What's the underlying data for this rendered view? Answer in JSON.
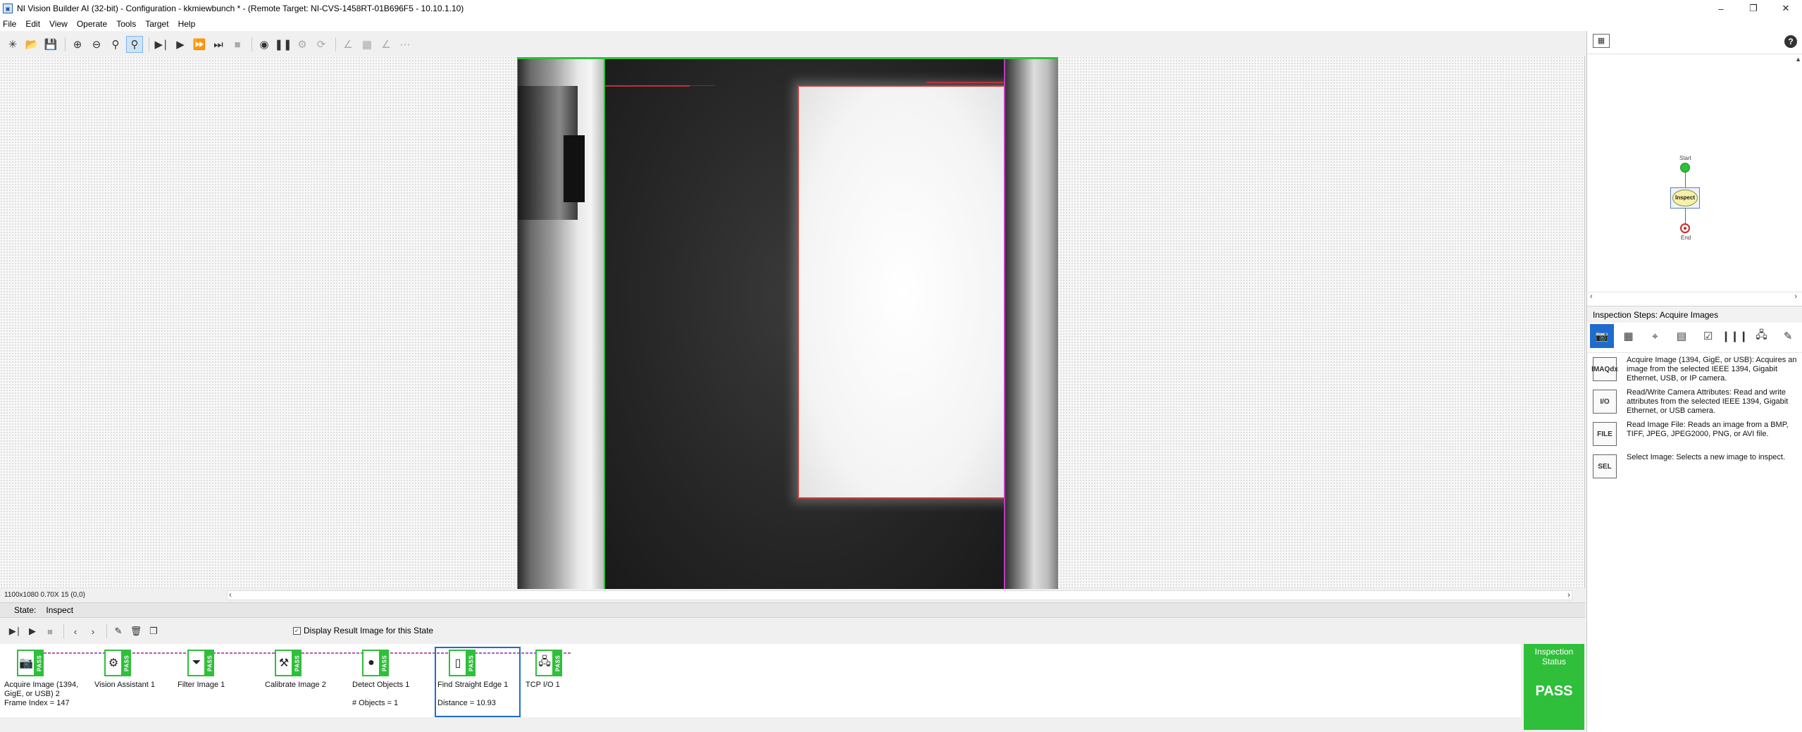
{
  "window": {
    "title": "NI Vision Builder AI (32-bit) - Configuration - kkmiewbunch * - (Remote Target: NI-CVS-1458RT-01B696F5 - 10.10.1.10)",
    "minimize": "–",
    "maximize": "❐",
    "close": "✕"
  },
  "menu": [
    "File",
    "Edit",
    "View",
    "Operate",
    "Tools",
    "Target",
    "Help"
  ],
  "toolbar": {
    "icons": [
      "new-icon",
      "open-icon",
      "save-icon",
      "zoom-in-icon",
      "zoom-out-icon",
      "zoom-fit-icon",
      "zoom-tool-icon",
      "run-once-icon",
      "run-icon",
      "run-continuous-icon",
      "step-icon",
      "stop-icon",
      "breakpoint-icon",
      "pause-icon",
      "calibration-icon",
      "reset-icon",
      "overlay1-icon",
      "overlay2-icon",
      "overlay3-icon",
      "overlay4-icon"
    ]
  },
  "image_status": {
    "resolution": "1100x1080 0.70X 15   (0,0)"
  },
  "state_bar": {
    "label": "State:",
    "value": "Inspect"
  },
  "steps_toolbar": {
    "display_result_label": "Display Result Image for this State",
    "display_result_checked": true
  },
  "steps": [
    {
      "name": "Acquire Image (1394, GigE, or USB) 2",
      "result": "Frame Index = 147",
      "status": "PASS",
      "icon": "camera-icon"
    },
    {
      "name": "Vision Assistant 1",
      "result": "",
      "status": "PASS",
      "icon": "vision-assistant-icon"
    },
    {
      "name": "Filter Image 1",
      "result": "",
      "status": "PASS",
      "icon": "filter-icon"
    },
    {
      "name": "Calibrate Image 2",
      "result": "",
      "status": "PASS",
      "icon": "calibrate-icon"
    },
    {
      "name": "Detect Objects 1",
      "result": "# Objects = 1",
      "status": "PASS",
      "icon": "detect-objects-icon"
    },
    {
      "name": "Find Straight Edge 1",
      "result": "Distance = 10.93",
      "status": "PASS",
      "icon": "edge-icon"
    },
    {
      "name": "TCP I/O 1",
      "result": "",
      "status": "PASS",
      "icon": "tcp-icon"
    }
  ],
  "inspection_status": {
    "title": "Inspection Status",
    "value": "PASS"
  },
  "right_panel": {
    "help": "?",
    "diagram": {
      "start_label": "Start",
      "inspect_label": "Inspect",
      "end_label": "End"
    },
    "steps_header": "Inspection Steps: Acquire Images",
    "palette_tabs": [
      "acquire-icon",
      "enhance-icon",
      "locate-icon",
      "measure-icon",
      "check-icon",
      "identify-icon",
      "communicate-icon",
      "custom-icon"
    ],
    "palette_items": [
      {
        "icon_label": "IMAQdx",
        "text": "Acquire Image (1394, GigE, or USB):  Acquires an image from the selected IEEE 1394, Gigabit Ethernet, USB, or IP camera."
      },
      {
        "icon_label": "I/O",
        "text": "Read/Write Camera Attributes:  Read and write attributes from the selected IEEE 1394, Gigabit Ethernet, or USB camera."
      },
      {
        "icon_label": "FILE",
        "text": "Read Image File:  Reads an image from a BMP, TIFF, JPEG, JPEG2000, PNG, or AVI file."
      },
      {
        "icon_label": "SEL",
        "text": "Select Image:  Selects a new image to inspect."
      }
    ]
  },
  "colors": {
    "pass_green": "#2fbf3a",
    "roi_red": "#c83838",
    "selection_blue": "#1f6ccf"
  }
}
